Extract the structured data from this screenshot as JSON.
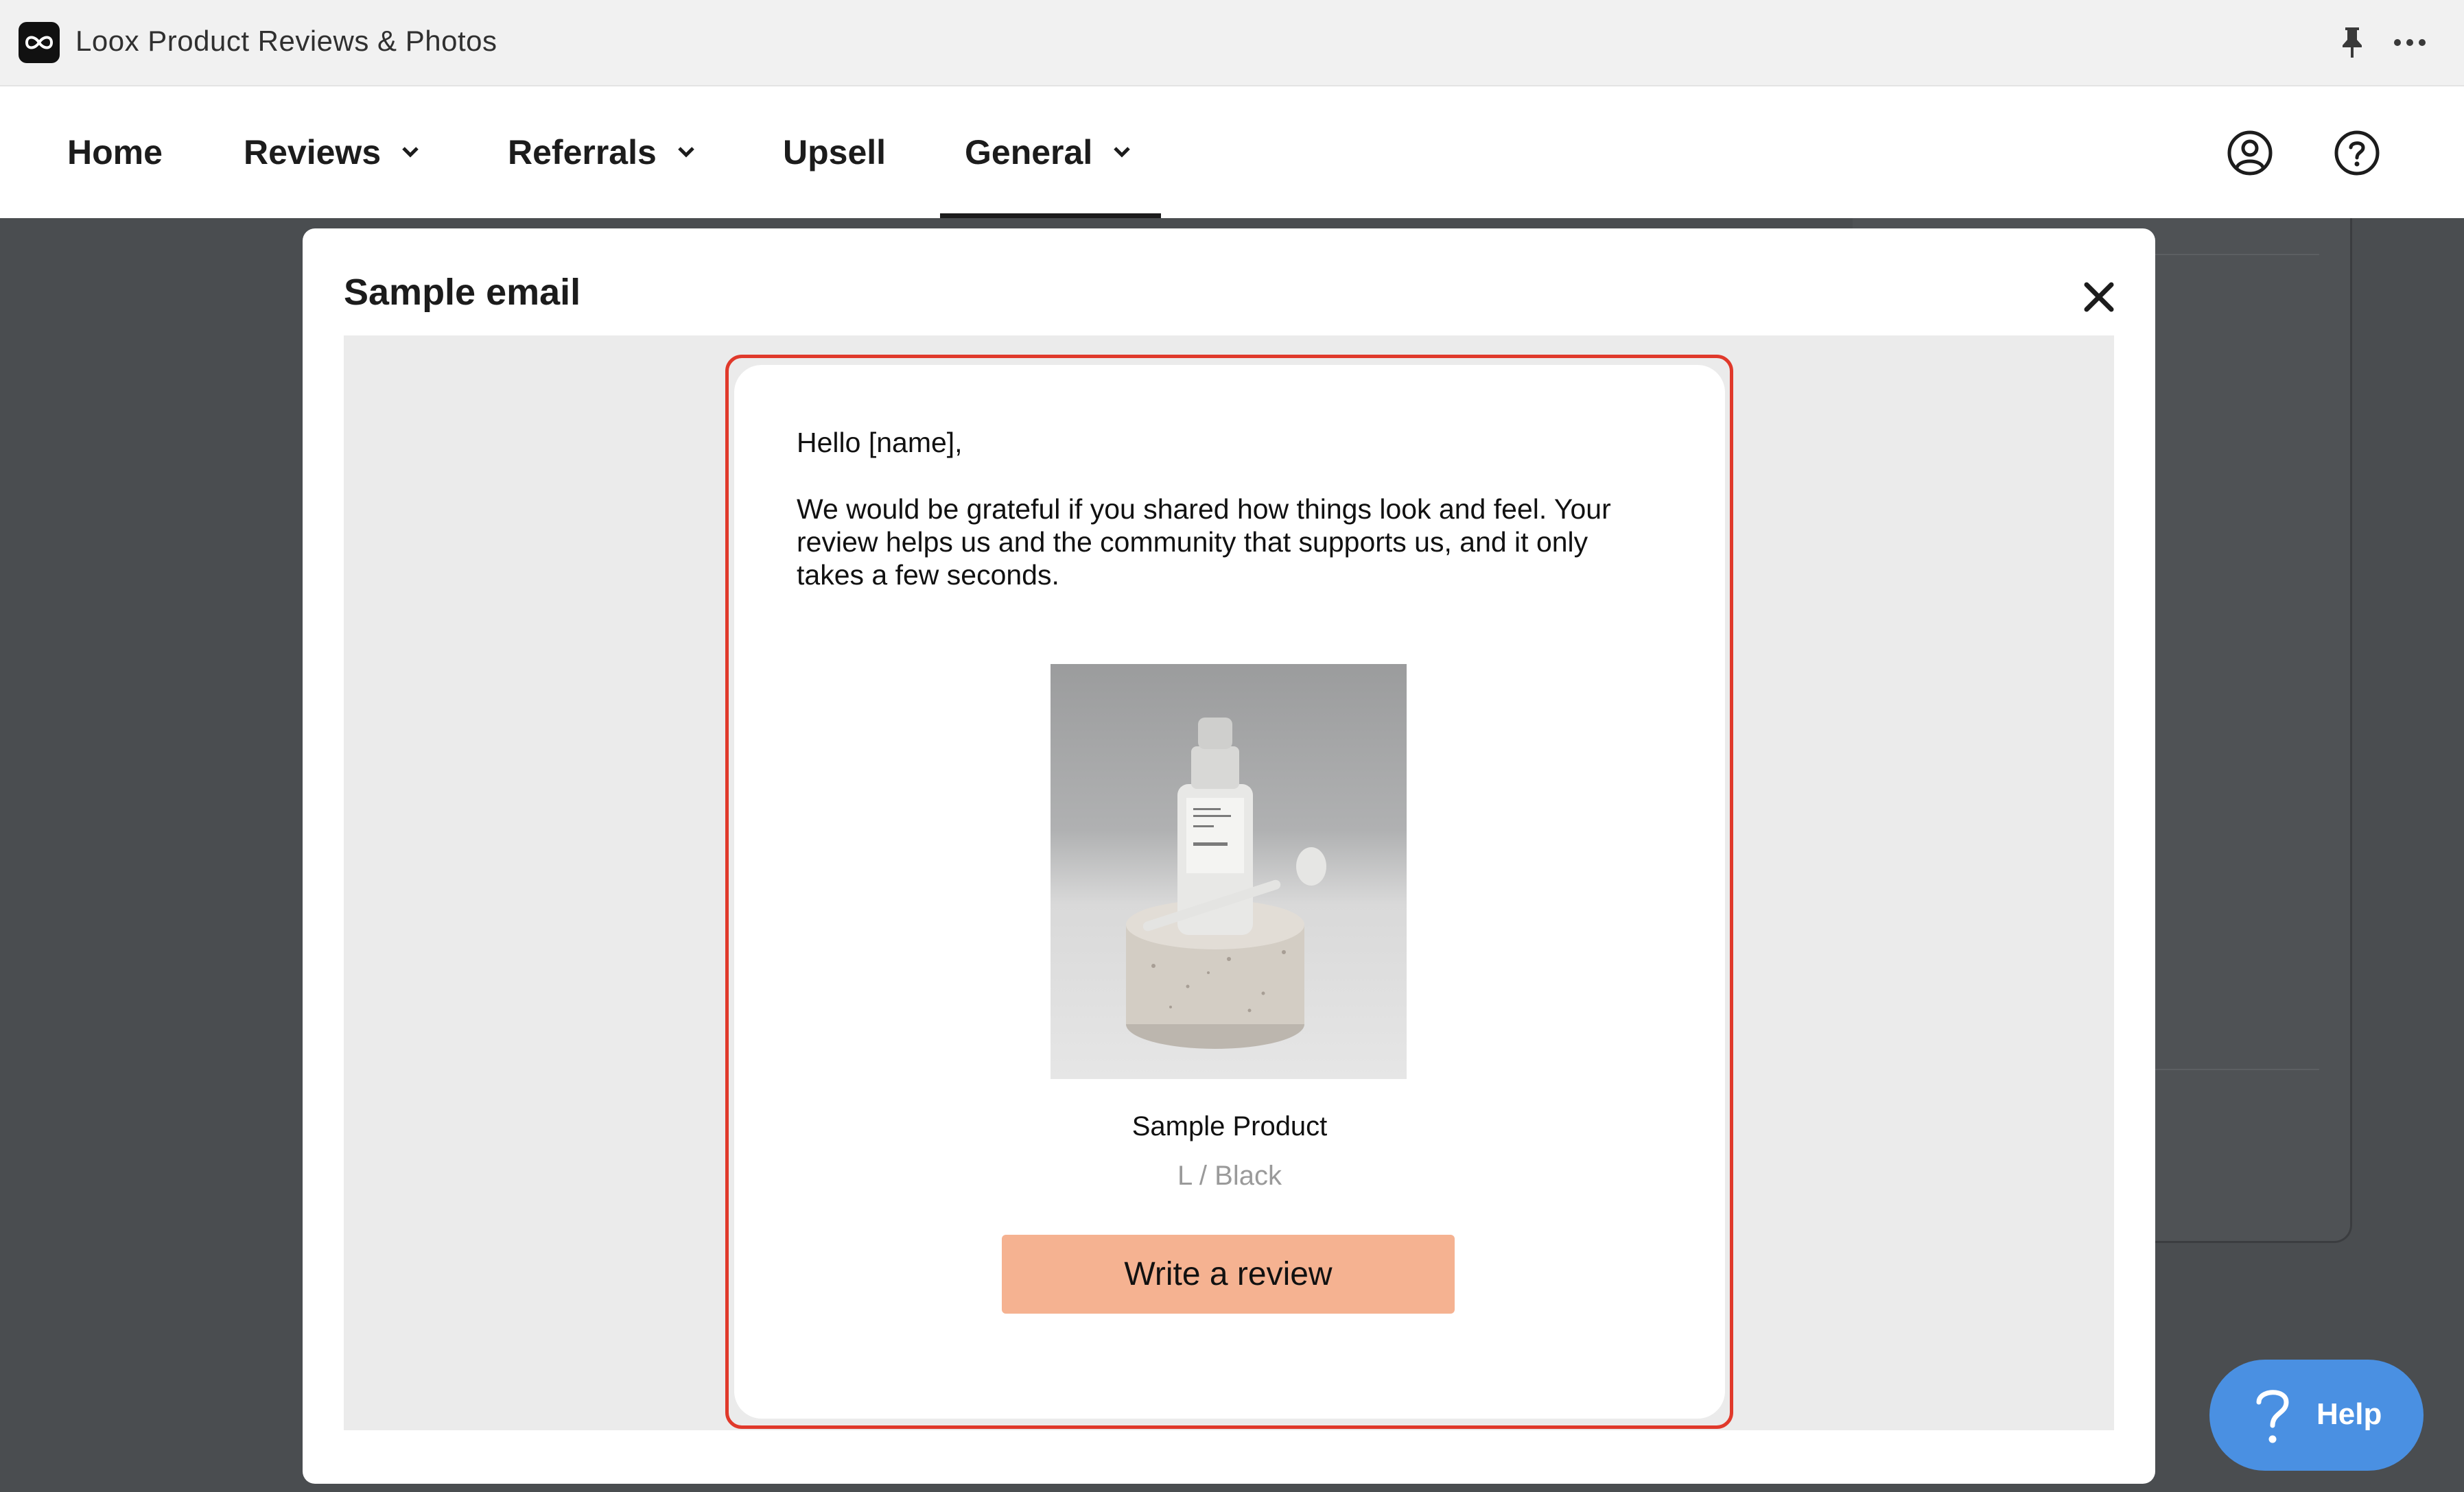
{
  "window": {
    "title": "Loox Product Reviews & Photos",
    "icons": {
      "app": "infinity-logo-icon",
      "pin": "pin-icon",
      "more": "more-horizontal-icon"
    }
  },
  "nav": {
    "items": [
      {
        "label": "Home",
        "has_dropdown": false
      },
      {
        "label": "Reviews",
        "has_dropdown": true
      },
      {
        "label": "Referrals",
        "has_dropdown": true
      },
      {
        "label": "Upsell",
        "has_dropdown": false
      },
      {
        "label": "General",
        "has_dropdown": true,
        "active": true
      }
    ],
    "icons": {
      "account": "user-circle-icon",
      "help": "question-circle-icon"
    }
  },
  "modal": {
    "title": "Sample email",
    "close_icon": "close-icon",
    "email": {
      "greeting": "Hello [name],",
      "body": "We would be grateful if you shared how things look and feel. Your review helps us and the community that supports us, and it only takes a few seconds.",
      "product": {
        "name": "Sample Product",
        "variant": "L / Black",
        "image": "serum-bottle-on-stone-pedestal"
      },
      "cta_label": "Write a review"
    }
  },
  "help_widget": {
    "label": "Help",
    "icon": "question-mark-icon"
  },
  "colors": {
    "highlight_outline": "#e0392b",
    "cta_background": "#f5b291",
    "help_widget": "#4a90e2",
    "overlay": "#4a4d50"
  }
}
